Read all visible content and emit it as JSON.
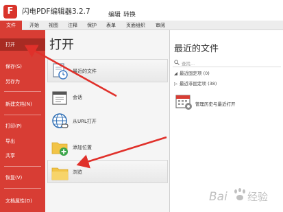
{
  "titlebar": {
    "logo_letter": "F",
    "title": "闪电PDF编辑器3.2.7",
    "menu": [
      "编辑",
      "转换"
    ]
  },
  "ribbon": {
    "tabs": [
      "文件",
      "开始",
      "视图",
      "注释",
      "保护",
      "表单",
      "页面组织",
      "审阅"
    ],
    "active": "文件"
  },
  "sidebar": {
    "items": [
      "打开",
      "保存(S)",
      "另存为",
      "新建文档(N)",
      "打印(P)",
      "导出",
      "共享",
      "恢复(V)",
      "文档属性(D)"
    ],
    "active": "打开"
  },
  "middle": {
    "heading": "打开",
    "options": [
      {
        "label": "最近的文件",
        "icon": "recent-file-icon"
      },
      {
        "label": "会话",
        "icon": "session-icon"
      },
      {
        "label": "从URL打开",
        "icon": "globe-link-icon"
      },
      {
        "label": "添加位置",
        "icon": "add-folder-icon"
      },
      {
        "label": "浏览",
        "icon": "folder-icon"
      }
    ]
  },
  "right": {
    "title": "最近的文件",
    "search_placeholder": "查找...",
    "groups": [
      "最近固定项 (0)",
      "最近非固定项 (38)"
    ],
    "history_item": "管理历史与最近打开"
  },
  "watermark": "Baidu 经验",
  "colors": {
    "accent": "#d83d34",
    "sidebar_active": "#a82b23",
    "arrow": "#e0302a"
  }
}
